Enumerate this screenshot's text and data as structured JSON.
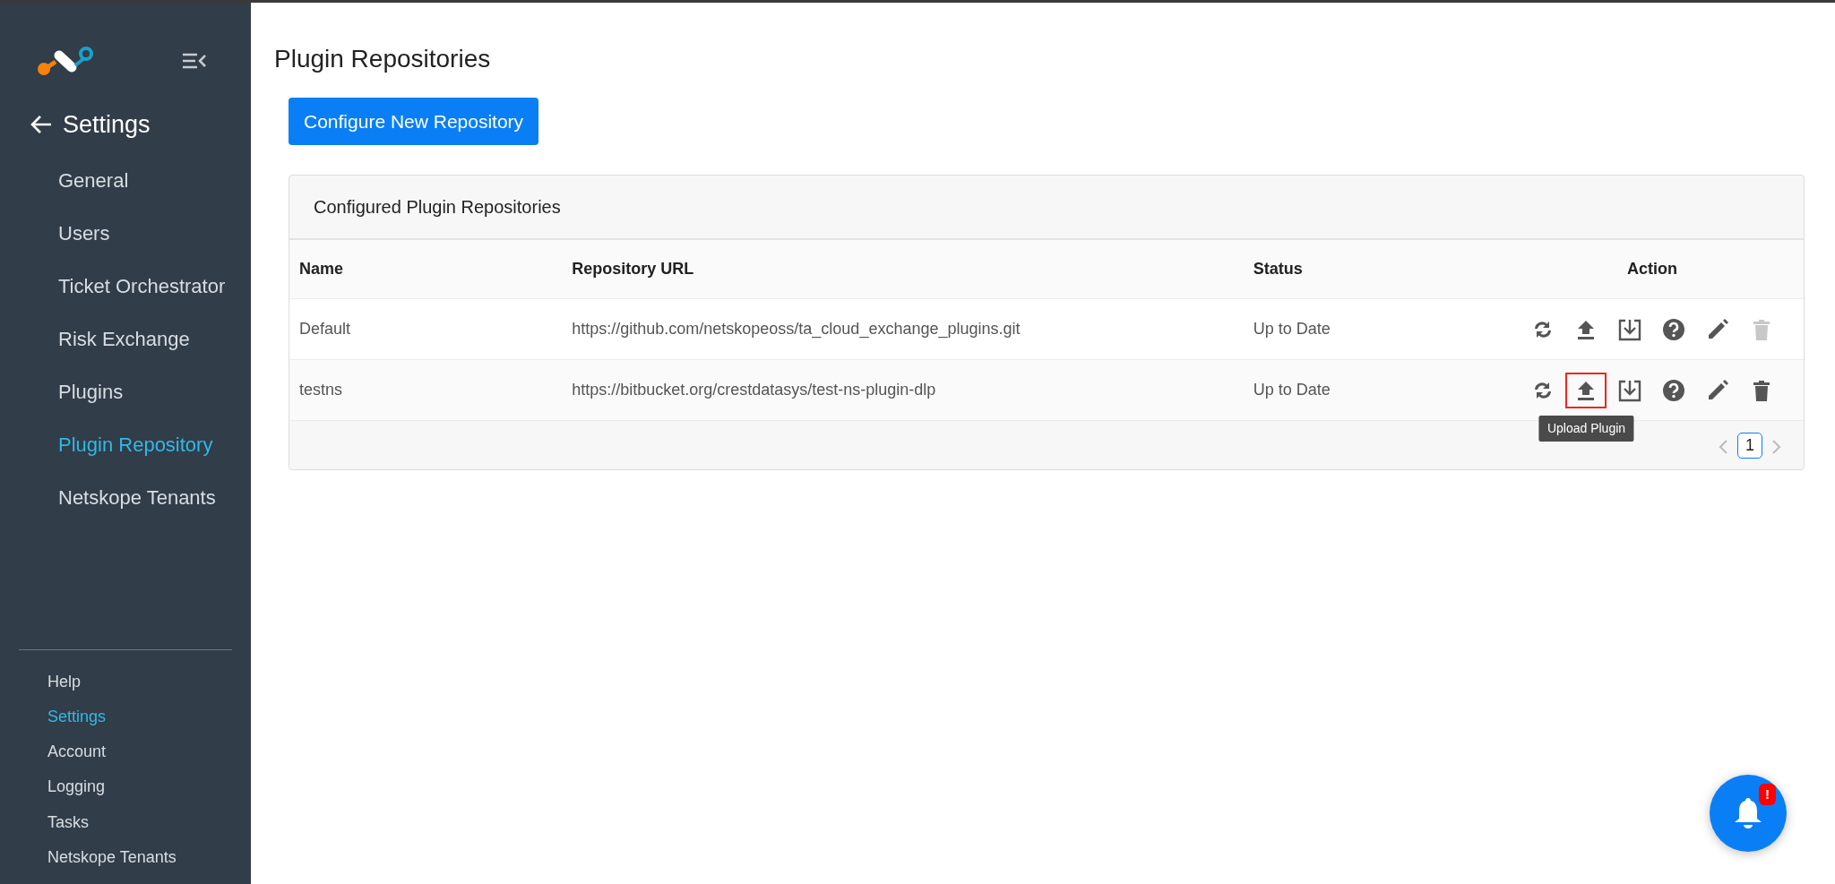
{
  "sidebar": {
    "back_label": "Settings",
    "items": [
      {
        "label": "General",
        "selected": false
      },
      {
        "label": "Users",
        "selected": false
      },
      {
        "label": "Ticket Orchestrator",
        "selected": false
      },
      {
        "label": "Risk Exchange",
        "selected": false
      },
      {
        "label": "Plugins",
        "selected": false
      },
      {
        "label": "Plugin Repository",
        "selected": true
      },
      {
        "label": "Netskope Tenants",
        "selected": false
      }
    ],
    "footer_items": [
      {
        "label": "Help",
        "selected": false
      },
      {
        "label": "Settings",
        "selected": true
      },
      {
        "label": "Account",
        "selected": false
      },
      {
        "label": "Logging",
        "selected": false
      },
      {
        "label": "Tasks",
        "selected": false
      },
      {
        "label": "Netskope Tenants",
        "selected": false
      }
    ]
  },
  "page_title": "Plugin Repositories",
  "primary_button": "Configure New Repository",
  "card": {
    "title": "Configured Plugin Repositories",
    "table": {
      "columns": [
        "Name",
        "Repository URL",
        "Status",
        "Action"
      ],
      "rows": [
        {
          "name": "Default",
          "url": "https://github.com/netskopeoss/ta_cloud_exchange_plugins.git",
          "status": "Up to Date",
          "actions": [
            {
              "kind": "sync",
              "disabled": false,
              "highlighted": false
            },
            {
              "kind": "upload",
              "disabled": false,
              "highlighted": false
            },
            {
              "kind": "import",
              "disabled": false,
              "highlighted": false
            },
            {
              "kind": "help",
              "disabled": false,
              "highlighted": false
            },
            {
              "kind": "edit",
              "disabled": false,
              "highlighted": false
            },
            {
              "kind": "delete",
              "disabled": true,
              "highlighted": false
            }
          ]
        },
        {
          "name": "testns",
          "url": "https://bitbucket.org/crestdatasys/test-ns-plugin-dlp",
          "status": "Up to Date",
          "actions": [
            {
              "kind": "sync",
              "disabled": false,
              "highlighted": false
            },
            {
              "kind": "upload",
              "disabled": false,
              "highlighted": true,
              "tooltip": "Upload Plugin"
            },
            {
              "kind": "import",
              "disabled": false,
              "highlighted": false
            },
            {
              "kind": "help",
              "disabled": false,
              "highlighted": false
            },
            {
              "kind": "edit",
              "disabled": false,
              "highlighted": false
            },
            {
              "kind": "delete",
              "disabled": false,
              "highlighted": false
            }
          ]
        }
      ]
    },
    "pagination": {
      "pages": [
        {
          "label": "1",
          "selected": true
        }
      ]
    }
  },
  "notifications": {
    "badge": "!"
  }
}
